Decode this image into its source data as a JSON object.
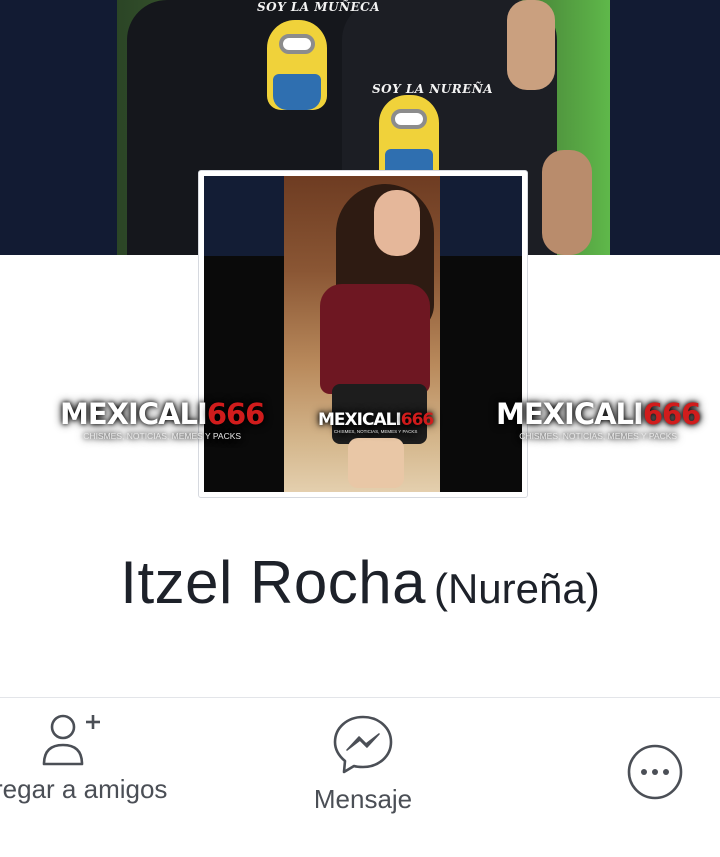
{
  "cover": {
    "shirt_text_left": "SOY LA MUÑECA",
    "shirt_text_right": "SOY LA NUREÑA"
  },
  "watermark": {
    "title": "MEXICALI",
    "number": "666",
    "subtitle": "CHISMES, NOTICIAS, MEMES Y PACKS"
  },
  "profile": {
    "name": "Itzel Rocha",
    "alternate_name": "(Nureña)"
  },
  "actions": {
    "add_friend_label": "regar a amigos",
    "add_friend_icon": "add-friend-icon",
    "message_label": "Mensaje",
    "message_icon": "messenger-icon",
    "more_icon": "more-options-icon"
  },
  "colors": {
    "cover_background": "#121b33",
    "icon_gray": "#4b4f56",
    "watermark_red": "#d01c1c",
    "text_dark": "#1d2129"
  }
}
